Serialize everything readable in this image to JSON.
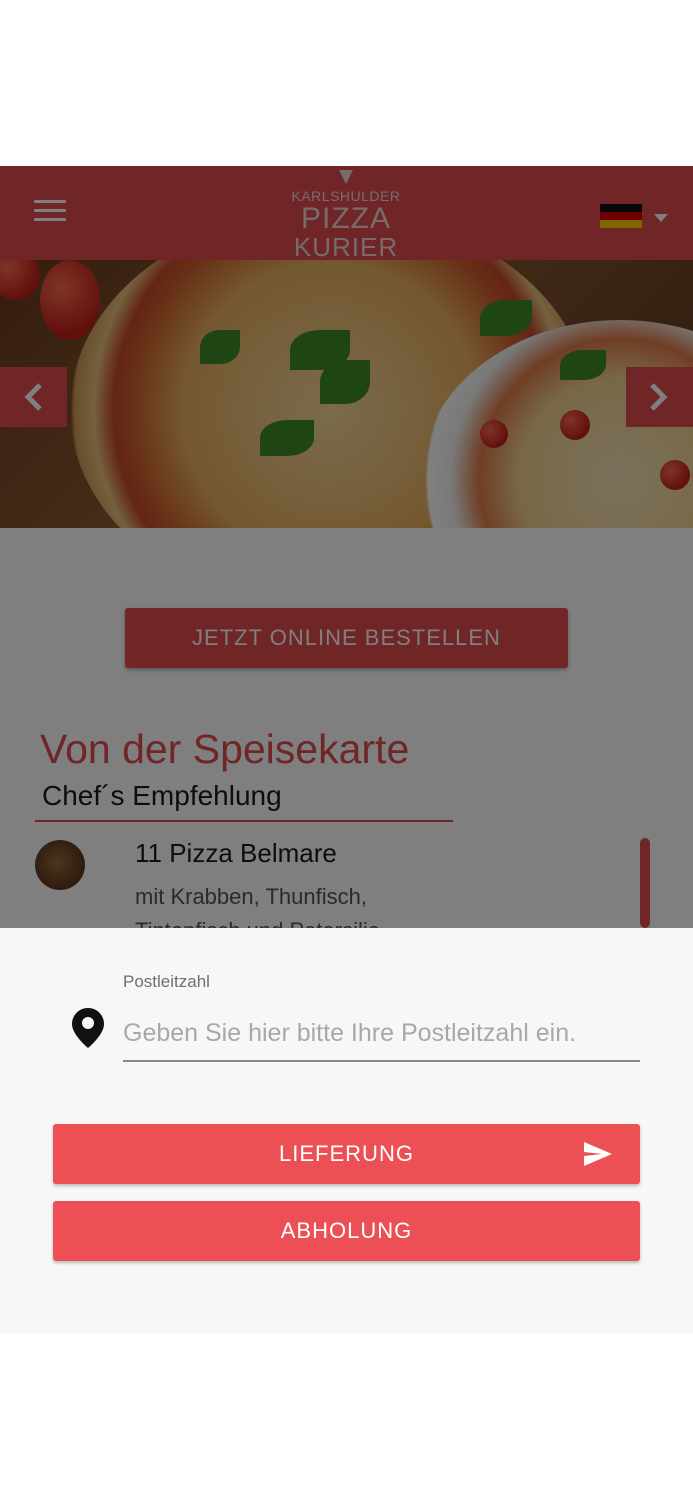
{
  "header": {
    "logo_line1": "KARLSHULDER",
    "logo_line2": "PIZZA",
    "logo_line3": "KURIER",
    "menu_icon": "hamburger-menu-icon",
    "language_flag": "germany-flag-icon"
  },
  "hero": {
    "prev_icon": "chevron-left-icon",
    "next_icon": "chevron-right-icon"
  },
  "main": {
    "order_button_label": "JETZT ONLINE BESTELLEN",
    "menu_title": "Von der Speisekarte",
    "menu_subtitle": "Chef´s Empfehlung",
    "dish": {
      "name": "11 Pizza Belmare",
      "description": "mit Krabben, Thunfisch, Tintenfisch und Petersilie"
    }
  },
  "sheet": {
    "zip_label": "Postleitzahl",
    "zip_placeholder": "Geben Sie hier bitte Ihre Postleitzahl ein.",
    "zip_value": "",
    "delivery_label": "LIEFERUNG",
    "pickup_label": "ABHOLUNG",
    "pin_icon": "location-pin-icon",
    "send_icon": "send-icon"
  },
  "colors": {
    "brand_red": "#e04a4f",
    "button_red": "#ec5055",
    "sheet_bg": "#f7f7f7"
  }
}
